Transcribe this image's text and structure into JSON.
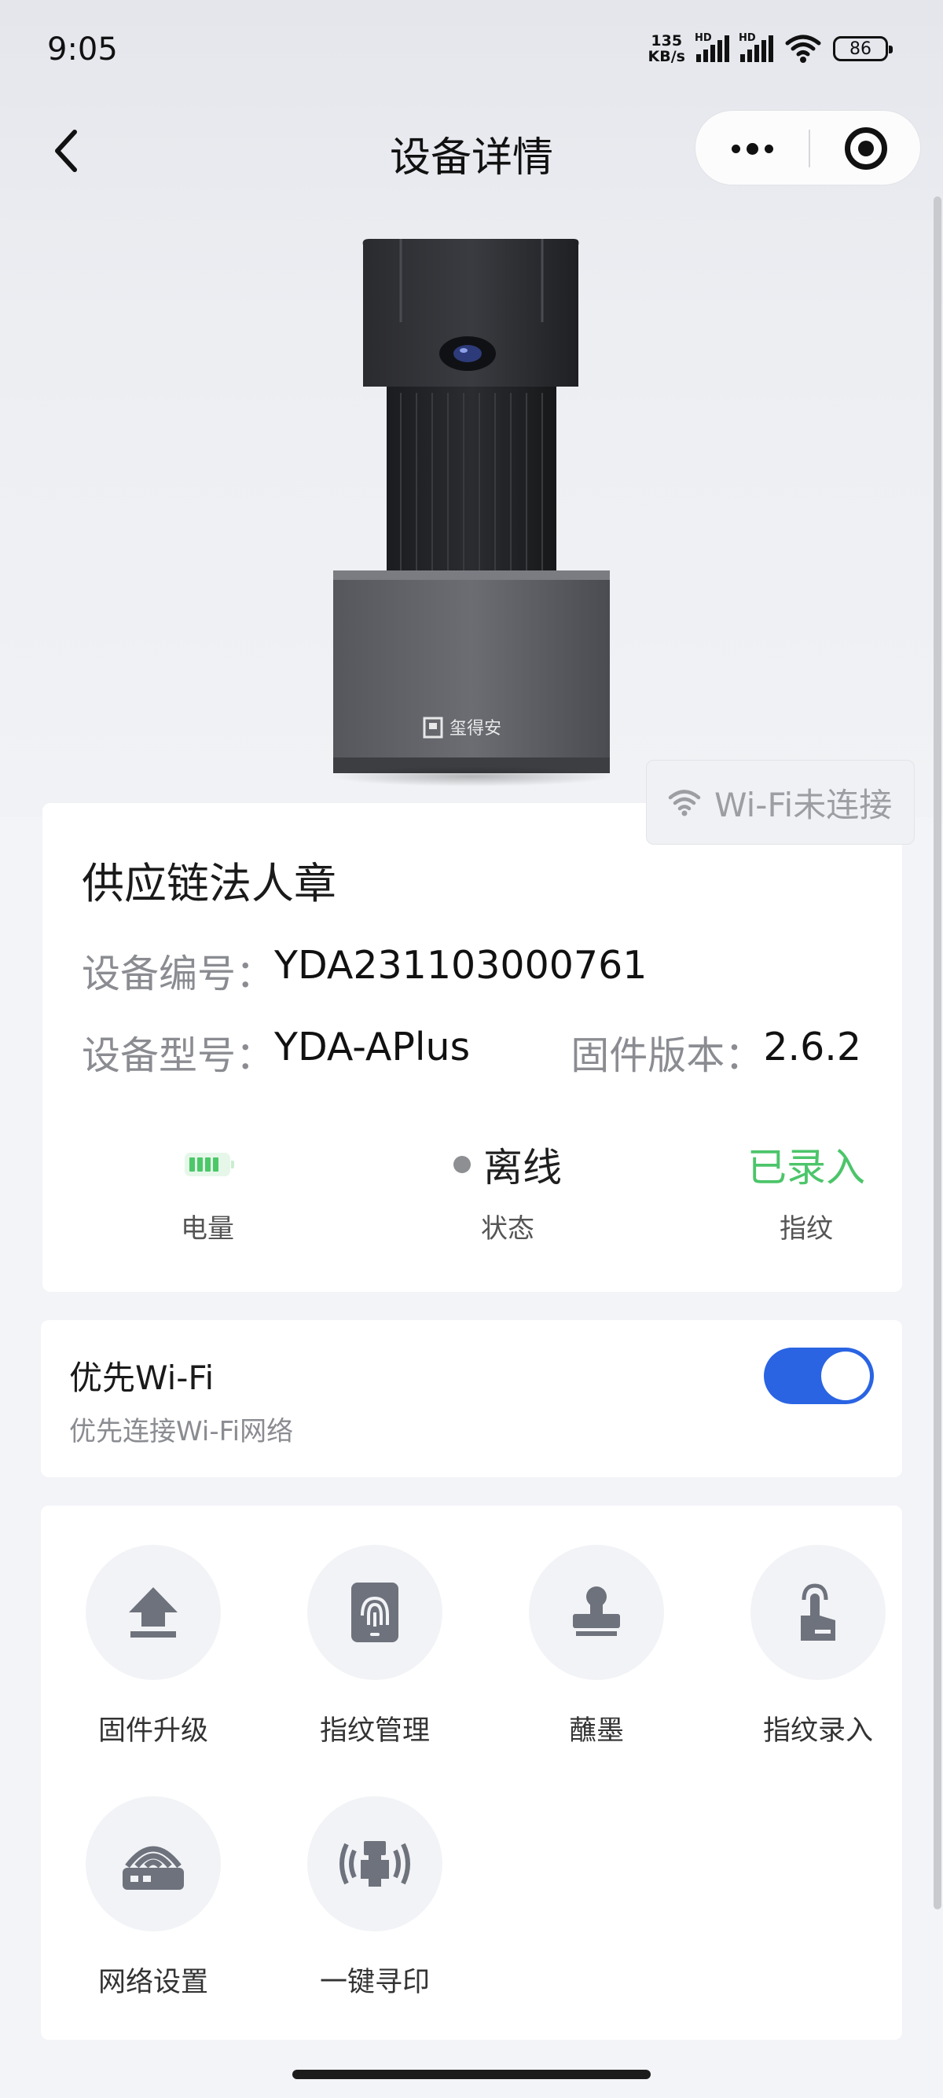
{
  "status_bar": {
    "time": "9:05",
    "net_speed_value": "135",
    "net_speed_unit": "KB/s",
    "signal1_label": "HD",
    "signal2_label": "HD",
    "battery": "86"
  },
  "nav": {
    "title": "设备详情",
    "back_icon": "chevron-left-icon",
    "more_icon": "more-dots-icon",
    "close_icon": "target-close-icon"
  },
  "wifi_status": {
    "label": "Wi-Fi未连接",
    "icon": "wifi-icon"
  },
  "device": {
    "name": "供应链法人章",
    "serial_label": "设备编号：",
    "serial_value": "YDA231103000761",
    "model_label": "设备型号：",
    "model_value": "YDA-APlus",
    "firmware_label": "固件版本：",
    "firmware_value": "2.6.2",
    "brand_mark": "玺得安"
  },
  "stats": {
    "battery_label": "电量",
    "battery_icon": "battery-icon",
    "state_value": "离线",
    "state_label": "状态",
    "fingerprint_value": "已录入",
    "fingerprint_label": "指纹"
  },
  "preference": {
    "title": "优先Wi-Fi",
    "subtitle": "优先连接Wi-Fi网络",
    "enabled": true
  },
  "functions": [
    {
      "label": "固件升级",
      "icon": "upload-icon"
    },
    {
      "label": "指纹管理",
      "icon": "fingerprint-icon"
    },
    {
      "label": "蘸墨",
      "icon": "stamp-icon"
    },
    {
      "label": "指纹录入",
      "icon": "finger-touch-icon"
    },
    {
      "label": "网络设置",
      "icon": "router-icon"
    },
    {
      "label": "一键寻印",
      "icon": "find-stamp-icon"
    }
  ],
  "colors": {
    "accent": "#2a64e3",
    "success": "#4cc56a",
    "icon_gray": "#6e727c"
  }
}
